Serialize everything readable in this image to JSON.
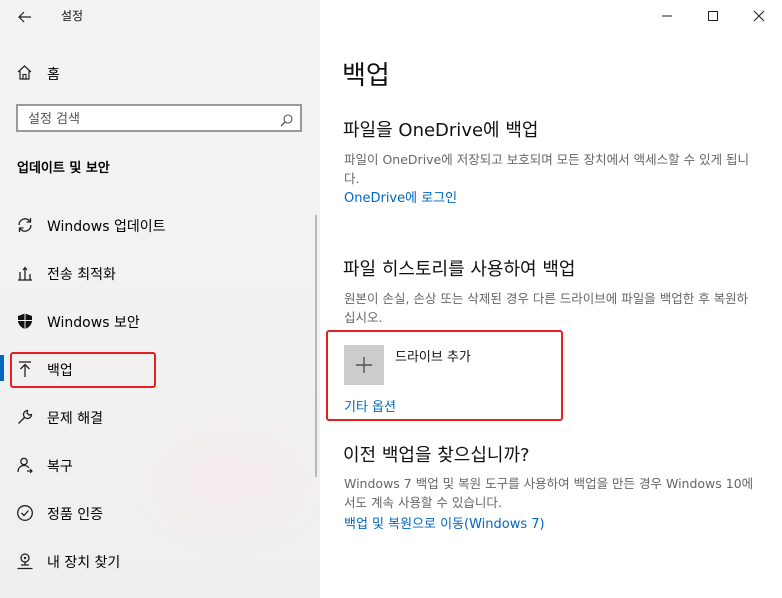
{
  "window": {
    "title": "설정",
    "minimize_icon": "minimize-icon",
    "maximize_icon": "maximize-icon",
    "close_icon": "close-icon"
  },
  "sidebar": {
    "home_label": "홈",
    "search_placeholder": "설정 검색",
    "section_title": "업데이트 및 보안",
    "items": [
      {
        "label": "Windows 업데이트",
        "icon": "sync-icon",
        "active": false
      },
      {
        "label": "전송 최적화",
        "icon": "delivery-optimization-icon",
        "active": false
      },
      {
        "label": "Windows 보안",
        "icon": "shield-icon",
        "active": false
      },
      {
        "label": "백업",
        "icon": "backup-arrow-icon",
        "active": true
      },
      {
        "label": "문제 해결",
        "icon": "wrench-icon",
        "active": false
      },
      {
        "label": "복구",
        "icon": "recovery-person-icon",
        "active": false
      },
      {
        "label": "정품 인증",
        "icon": "check-circle-icon",
        "active": false
      },
      {
        "label": "내 장치 찾기",
        "icon": "find-device-icon",
        "active": false
      }
    ]
  },
  "main": {
    "page_title": "백업",
    "onedrive": {
      "heading": "파일을 OneDrive에 백업",
      "description": "파일이 OneDrive에 저장되고 보호되며 모든 장치에서 액세스할 수 있게 됩니다.",
      "link": "OneDrive에 로그인"
    },
    "file_history": {
      "heading": "파일 히스토리를 사용하여 백업",
      "description": "원본이 손실, 손상 또는 삭제된 경우 다른 드라이브에 파일을 백업한 후 복원하십시오.",
      "add_drive_label": "드라이브 추가",
      "more_options": "기타 옵션"
    },
    "older_backup": {
      "heading": "이전 백업을 찾으십니까?",
      "description": "Windows 7 백업 및 복원 도구를 사용하여 백업을 만든 경우 Windows 10에서도 계속 사용할 수 있습니다.",
      "link": "백업 및 복원으로 이동(Windows 7)"
    }
  },
  "colors": {
    "accent": "#0067c0",
    "highlight": "#e62020",
    "sidebar_bg": "#f2f2f2"
  }
}
